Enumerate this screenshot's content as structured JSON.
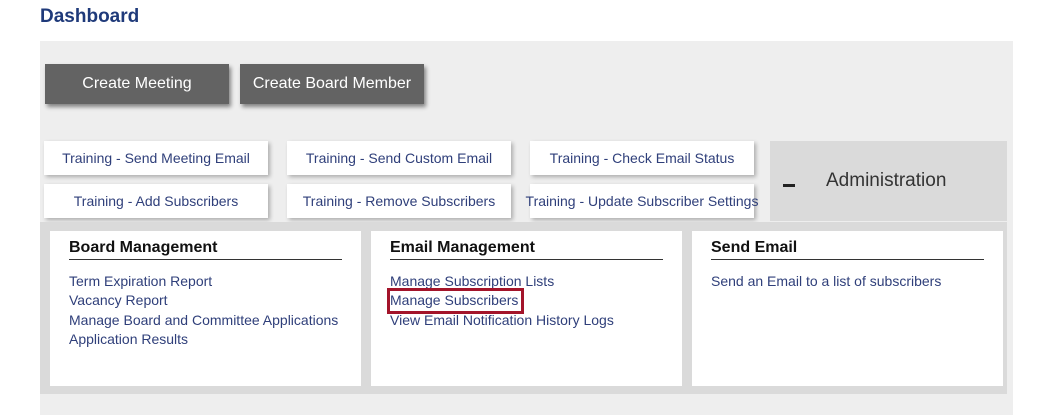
{
  "page": {
    "title": "Dashboard"
  },
  "actions": {
    "create_meeting": "Create Meeting",
    "create_board_member": "Create Board Member"
  },
  "training": {
    "send_meeting_email": "Training - Send Meeting Email",
    "send_custom_email": "Training - Send Custom Email",
    "check_email_status": "Training - Check Email Status",
    "add_subscribers": "Training - Add Subscribers",
    "remove_subscribers": "Training - Remove Subscribers",
    "update_subscriber_settings": "Training - Update Subscriber Settings"
  },
  "administration": {
    "label": "Administration",
    "toggle_symbol": "minus"
  },
  "cards": {
    "board_management": {
      "title": "Board Management",
      "links": [
        "Term Expiration Report",
        "Vacancy Report",
        "Manage Board and Committee Applications",
        "Application Results"
      ]
    },
    "email_management": {
      "title": "Email Management",
      "links": [
        "Manage Subscription Lists",
        "Manage Subscribers",
        "View Email Notification History Logs"
      ],
      "highlighted": "Manage Subscribers"
    },
    "send_email": {
      "title": "Send Email",
      "links": [
        "Send an Email to a list of subscribers"
      ]
    }
  },
  "colors": {
    "title": "#1f3a7a",
    "link": "#2f3f7a",
    "highlight": "#a3142a",
    "button": "#636363"
  }
}
